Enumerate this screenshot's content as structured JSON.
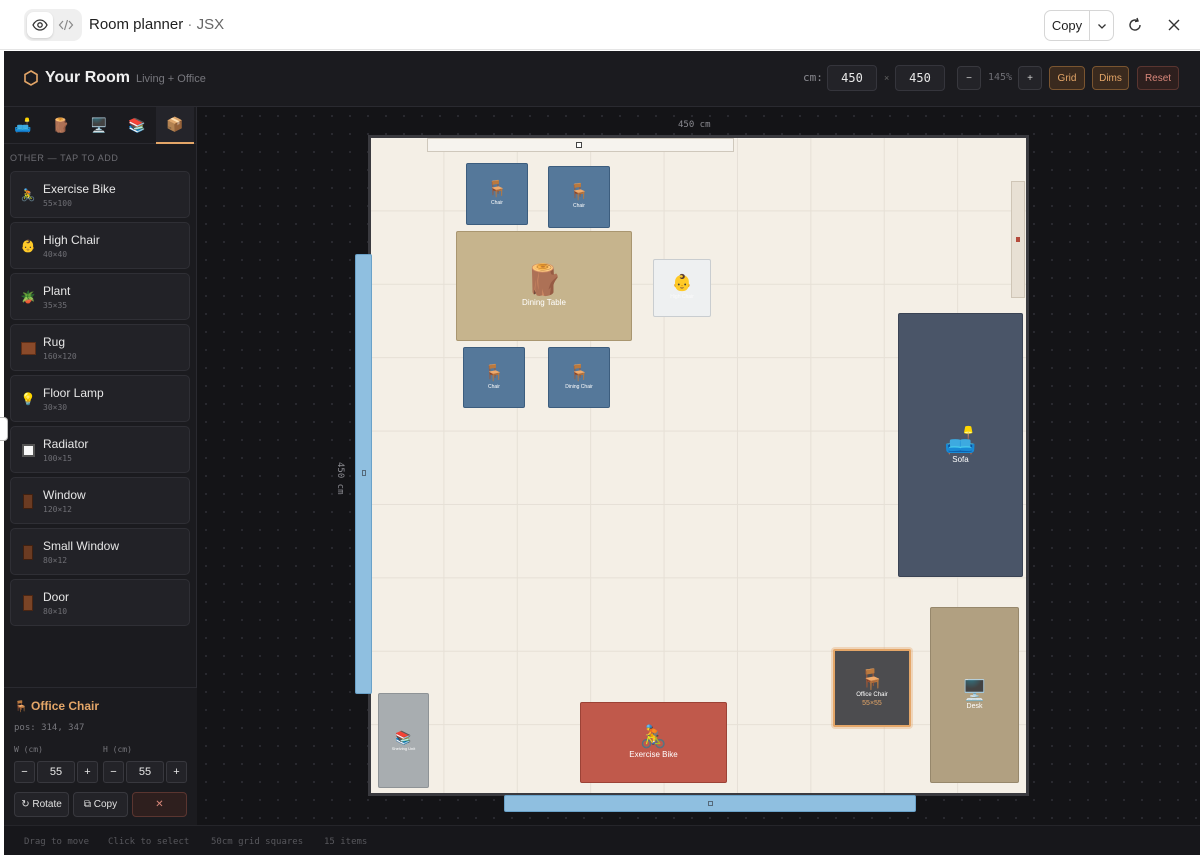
{
  "artifact": {
    "title": "Room planner",
    "separator": " · ",
    "type": "JSX",
    "copy_label": "Copy"
  },
  "app": {
    "title": "Your Room",
    "subtitle": "Living + Office",
    "cm_label": "cm:",
    "width_value": "450",
    "height_value": "450",
    "times": "×",
    "zoom_out": "−",
    "zoom_level": "145%",
    "zoom_in": "+",
    "grid_label": "Grid",
    "dims_label": "Dims",
    "reset_label": "Reset"
  },
  "sidebar": {
    "category_icons": [
      "sofa-icon",
      "wood-icon",
      "monitor-icon",
      "books-icon",
      "box-icon"
    ],
    "section_label": "OTHER — TAP TO ADD",
    "items": [
      {
        "name": "Exercise Bike",
        "size": "55×100",
        "icon": "🚴"
      },
      {
        "name": "High Chair",
        "size": "40×40",
        "icon": "👶"
      },
      {
        "name": "Plant",
        "size": "35×35",
        "icon": "🪴"
      },
      {
        "name": "Rug",
        "size": "160×120",
        "icon": "rug"
      },
      {
        "name": "Floor Lamp",
        "size": "30×30",
        "icon": "💡"
      },
      {
        "name": "Radiator",
        "size": "100×15",
        "icon": "radiator"
      },
      {
        "name": "Window",
        "size": "120×12",
        "icon": "window"
      },
      {
        "name": "Small Window",
        "size": "80×12",
        "icon": "window"
      },
      {
        "name": "Door",
        "size": "80×10",
        "icon": "door"
      }
    ]
  },
  "selection": {
    "title": "Office Chair",
    "pos": "pos: 314, 347",
    "w_label": "W (cm)",
    "h_label": "H (cm)",
    "w_value": "55",
    "h_value": "55",
    "minus": "−",
    "plus": "+",
    "rotate_label": "↻ Rotate",
    "copy_label": "⧉ Copy",
    "delete_label": "✕"
  },
  "canvas": {
    "top_dimension": "450 cm",
    "left_dimension": "450 cm",
    "furniture": {
      "chair_1": "Chair",
      "chair_2": "Chair",
      "dining_table": "Dining Table",
      "high_chair": "High Chair",
      "chair_3": "Chair",
      "dining_chair": "Dining Chair",
      "sofa": "Sofa",
      "office_chair": "Office Chair",
      "office_chair_size": "55×55",
      "desk": "Desk",
      "exercise_bike": "Exercise Bike",
      "shelving": "Shelving Unit"
    }
  },
  "status": {
    "drag": "Drag to move",
    "click": "Click to select",
    "grid": "50cm grid squares",
    "count": "15 items"
  },
  "colors": {
    "accent": "#e4a668",
    "room_floor": "#f4efe6",
    "chair_blue": "#55789a",
    "table_tan": "#c6b48d",
    "sofa_slate": "#4a5568",
    "desk_tan": "#b1a081",
    "bike_red": "#c0594b",
    "wall_blue": "#8fbfe0"
  }
}
